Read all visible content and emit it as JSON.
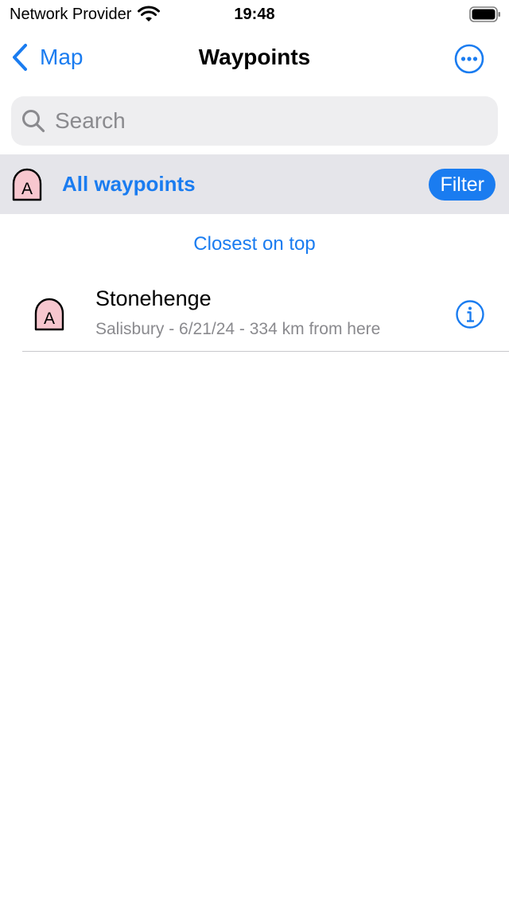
{
  "status_bar": {
    "carrier": "Network Provider",
    "time": "19:48",
    "wifi_icon": "wifi-icon",
    "battery_icon": "battery-icon"
  },
  "nav": {
    "back_label": "Map",
    "title": "Waypoints",
    "more_icon": "ellipsis-circle-icon"
  },
  "search": {
    "placeholder": "Search"
  },
  "filter_row": {
    "badge_letter": "A",
    "title": "All waypoints",
    "filter_button": "Filter"
  },
  "sort_label": "Closest on top",
  "waypoints": [
    {
      "badge_letter": "A",
      "name": "Stonehenge",
      "subtitle": "Salisbury - 6/21/24 - 334 km from here"
    }
  ],
  "colors": {
    "accent": "#1a7cf0",
    "badge_fill": "#f7c7cf",
    "filter_row_bg": "#e5e5ea",
    "search_bg": "#eeeef0",
    "secondary_text": "#8a8a8e"
  }
}
